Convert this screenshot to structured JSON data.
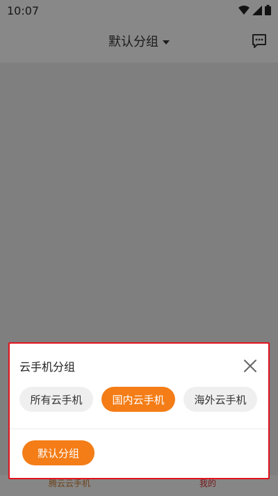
{
  "status_bar": {
    "time": "10:07",
    "icons": [
      "wifi-icon",
      "signal-icon",
      "battery-icon"
    ]
  },
  "header": {
    "title": "默认分组",
    "message_icon": "message-icon"
  },
  "bottom_nav": {
    "left_label": "腾云云手机",
    "right_label": "我的"
  },
  "sheet": {
    "title": "云手机分组",
    "filters": [
      {
        "label": "所有云手机",
        "active": false
      },
      {
        "label": "国内云手机",
        "active": true
      },
      {
        "label": "海外云手机",
        "active": false
      }
    ],
    "groups": [
      {
        "label": "默认分组"
      }
    ]
  },
  "colors": {
    "accent": "#f47d17",
    "highlight_border": "#e1121c"
  }
}
